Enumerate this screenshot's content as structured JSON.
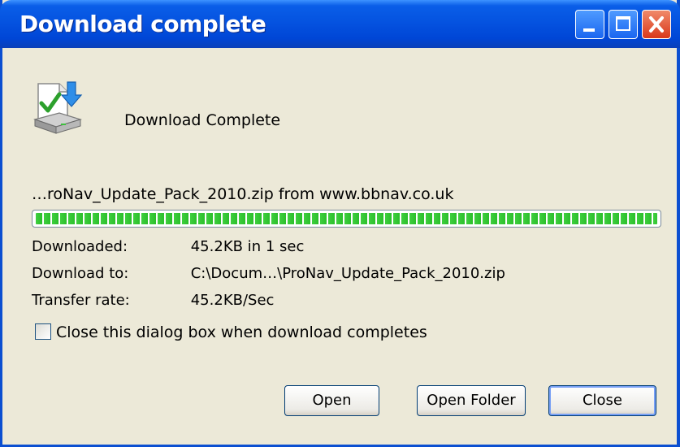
{
  "window": {
    "title": "Download complete",
    "controls": [
      "minimize",
      "maximize",
      "close"
    ]
  },
  "heading": "Download Complete",
  "source_line": "…roNav_Update_Pack_2010.zip from www.bbnav.co.uk",
  "progress_fraction": 1.0,
  "details": [
    {
      "label": "Downloaded:",
      "value": "45.2KB in 1 sec"
    },
    {
      "label": "Download to:",
      "value": "C:\\Docum…\\ProNav_Update_Pack_2010.zip"
    },
    {
      "label": "Transfer rate:",
      "value": "45.2KB/Sec"
    }
  ],
  "close_when_complete": {
    "label": "Close this dialog box when download completes",
    "checked": false
  },
  "buttons": {
    "open": "Open",
    "open_folder": "Open Folder",
    "close": "Close"
  },
  "icons": [
    "download-complete-icon"
  ],
  "colors": {
    "titlebar": "#0553e0",
    "progress": "#2bbf2b",
    "dialog_bg": "#ece9d8",
    "close_control": "#d9381b"
  }
}
